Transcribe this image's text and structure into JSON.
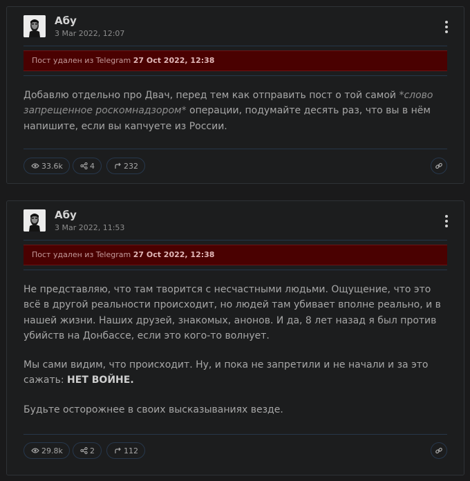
{
  "posts": [
    {
      "author": "Абу",
      "date": "3 Mar 2022, 12:07",
      "deleted_prefix": "Пост удален из Telegram",
      "deleted_date": "27 Oct 2022, 12:38",
      "text_a": "Добавлю отдельно про Двач, перед тем как отправить пост о той самой ",
      "text_em": "*слово запрещенное роскомнадзором*",
      "text_b": " операции, подумайте десять раз, что вы в нём напишите, если вы капчуете из России.",
      "views": "33.6k",
      "shares": "4",
      "forwards": "232"
    },
    {
      "author": "Абу",
      "date": "3 Mar 2022, 11:53",
      "deleted_prefix": "Пост удален из Telegram",
      "deleted_date": "27 Oct 2022, 12:38",
      "para1": "Не представляю, что там творится с несчастными людьми. Ощущение, что это всё в другой реальности происходит, но людей там убивает вполне реально, и в нашей жизни. Наших друзей, знакомых, анонов. И да, 8 лет назад я был против убийств на Донбассе, если это кого-то волнует.",
      "para2_a": "Мы сами видим, что происходит. Ну, и пока не запретили и не начали и за это сажать: ",
      "para2_bold": "НЕТ ВОЙНЕ.",
      "para3": "Будьте осторожнее в своих высказываниях везде.",
      "views": "29.8k",
      "shares": "2",
      "forwards": "112"
    }
  ],
  "icons": {
    "menu": "more-vertical-icon",
    "views": "eye-icon",
    "shares": "share-icon",
    "forwards": "forward-arrow-icon",
    "link": "link-icon"
  },
  "colors": {
    "background": "#1a1a1b",
    "card": "#1c1d1e",
    "deleted_banner": "#4a0101",
    "separator": "#26374a"
  }
}
